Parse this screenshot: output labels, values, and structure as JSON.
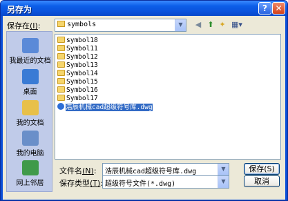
{
  "window": {
    "title": "另存为",
    "help_icon": "?",
    "close_icon": "✕"
  },
  "toolbar": {
    "save_in_label": "保存在",
    "save_in_key": "(I)",
    "save_in_suffix": ":",
    "current_folder": "symbols"
  },
  "places": [
    {
      "label": "我最近的文档",
      "icon": "recent-documents-icon",
      "color": "#5b8ad8"
    },
    {
      "label": "桌面",
      "icon": "desktop-icon",
      "color": "#3a7bd5"
    },
    {
      "label": "我的文档",
      "icon": "my-documents-icon",
      "color": "#e8c04a"
    },
    {
      "label": "我的电脑",
      "icon": "my-computer-icon",
      "color": "#6a8fc9"
    },
    {
      "label": "网上邻居",
      "icon": "network-places-icon",
      "color": "#3f9a4a"
    }
  ],
  "files": [
    {
      "name": "symbol18",
      "type": "folder"
    },
    {
      "name": "Symbol11",
      "type": "folder"
    },
    {
      "name": "Symbol12",
      "type": "folder"
    },
    {
      "name": "Symbol13",
      "type": "folder"
    },
    {
      "name": "Symbol14",
      "type": "folder"
    },
    {
      "name": "Symbol15",
      "type": "folder"
    },
    {
      "name": "Symbol16",
      "type": "folder"
    },
    {
      "name": "Symbol17",
      "type": "folder"
    },
    {
      "name": "浩辰机械cad超级符号库.dwg",
      "type": "dwg",
      "selected": true
    }
  ],
  "form": {
    "filename_label": "文件名",
    "filename_key": "(N)",
    "filename_value": "浩辰机械cad超级符号库.dwg",
    "filetype_label": "保存类型",
    "filetype_key": "(T)",
    "filetype_value": "超级符号文件(*.dwg)",
    "colon": ":"
  },
  "buttons": {
    "save": "保存(S)",
    "cancel": "取消"
  },
  "colors": {
    "titlebar": "#0a53dd",
    "selection": "#316ac5",
    "places_bg": "#c0cbe9"
  }
}
